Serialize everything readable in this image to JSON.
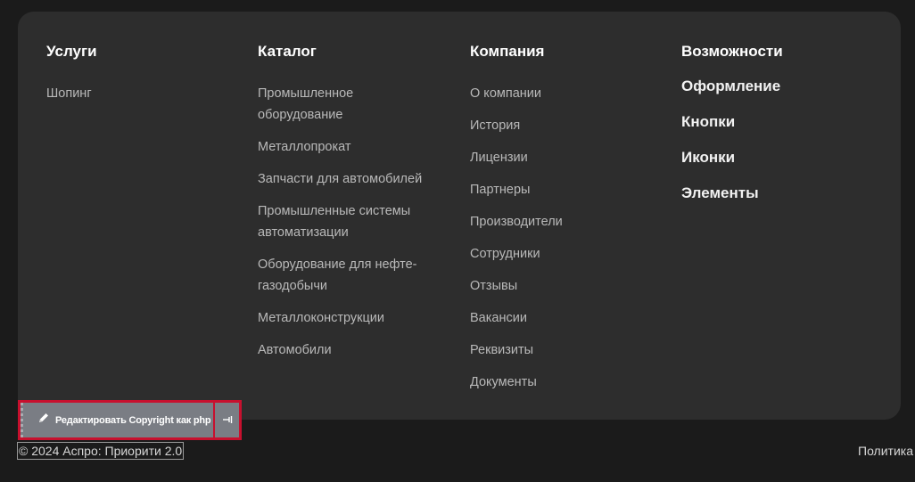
{
  "footer": {
    "columns": [
      {
        "title": "Услуги",
        "items": [
          "Шопинг"
        ]
      },
      {
        "title": "Каталог",
        "items": [
          "Промышленное оборудование",
          "Металлопрокат",
          "Запчасти для автомобилей",
          "Промышленные системы автоматизации",
          "Оборудование для нефте-газодобычи",
          "Металлоконструкции",
          "Автомобили"
        ]
      },
      {
        "title": "Компания",
        "items": [
          "О компании",
          "История",
          "Лицензии",
          "Партнеры",
          "Производители",
          "Сотрудники",
          "Отзывы",
          "Вакансии",
          "Реквизиты",
          "Документы"
        ]
      },
      {
        "title": "Возможности",
        "items": [
          "Оформление",
          "Кнопки",
          "Иконки",
          "Элементы"
        ]
      }
    ]
  },
  "edit_toolbar": {
    "label": "Редактировать Copyright как php",
    "edit_icon": "pencil-icon",
    "pin_icon": "pin-icon",
    "highlight_color": "#c8102e"
  },
  "bottom": {
    "copyright": "© 2024 Аспро: Приорити 2.0",
    "policy": "Политика"
  }
}
